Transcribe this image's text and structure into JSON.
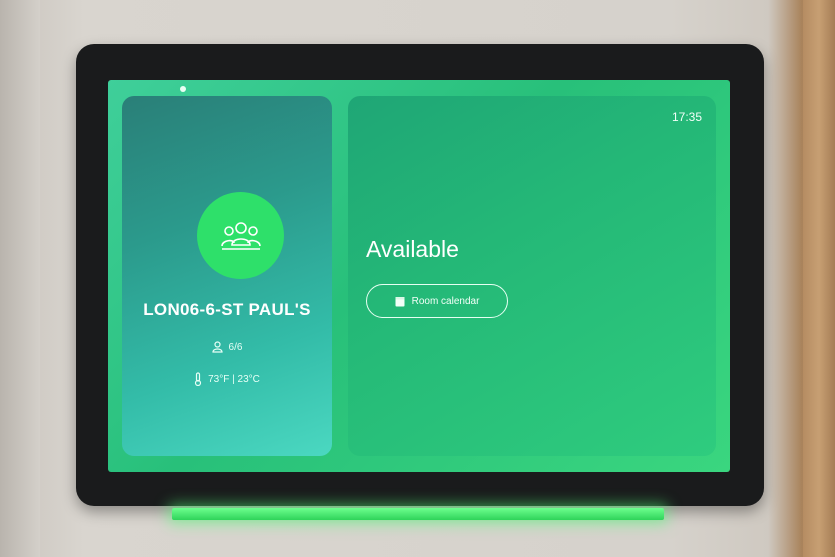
{
  "device": {
    "clock": "17:35",
    "room": {
      "name": "LON06-6-ST PAUL'S",
      "capacity": "6/6",
      "temperature": "73°F | 23°C",
      "avatar_icon": "people-group-icon"
    },
    "availability": {
      "status": "Available",
      "button_label": "Room calendar",
      "button_icon": "calendar-icon"
    },
    "colors": {
      "accent": "#2ee06a",
      "screen": "#28c07a",
      "led": "#4dff7a"
    }
  }
}
